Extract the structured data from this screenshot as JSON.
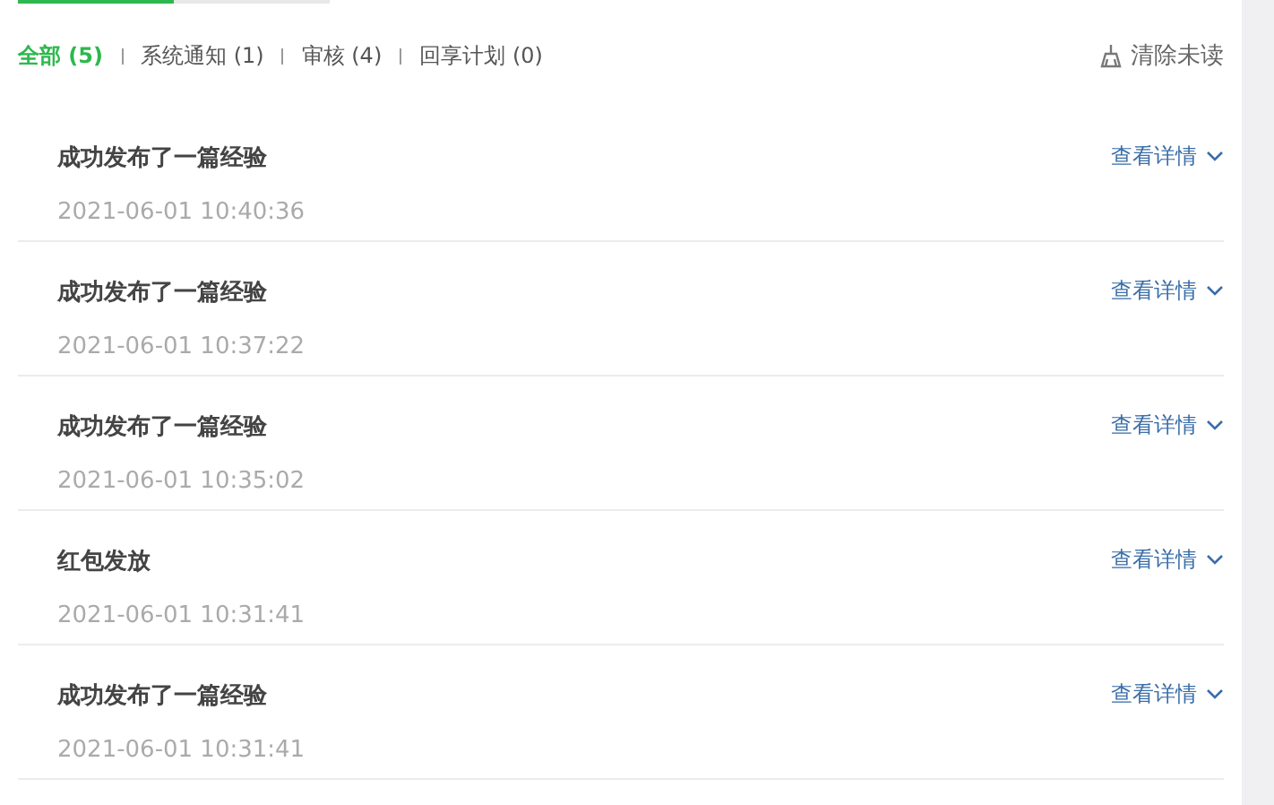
{
  "top_tabs": [
    {
      "selected": true
    },
    {
      "selected": false
    }
  ],
  "filters": [
    {
      "label": "全部 (5)",
      "selected": true
    },
    {
      "label": "系统通知 (1)",
      "selected": false
    },
    {
      "label": "审核 (4)",
      "selected": false
    },
    {
      "label": "回享计划 (0)",
      "selected": false
    }
  ],
  "clear_unread": "清除未读",
  "messages": [
    {
      "title": "成功发布了一篇经验",
      "time": "2021-06-01 10:40:36",
      "action": "查看详情"
    },
    {
      "title": "成功发布了一篇经验",
      "time": "2021-06-01 10:37:22",
      "action": "查看详情"
    },
    {
      "title": "成功发布了一篇经验",
      "time": "2021-06-01 10:35:02",
      "action": "查看详情"
    },
    {
      "title": "红包发放",
      "time": "2021-06-01 10:31:41",
      "action": "查看详情"
    },
    {
      "title": "成功发布了一篇经验",
      "time": "2021-06-01 10:31:41",
      "action": "查看详情"
    }
  ]
}
